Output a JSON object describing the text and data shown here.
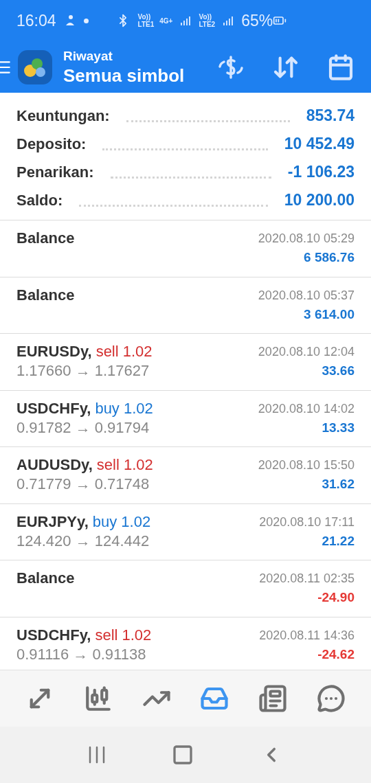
{
  "status_bar": {
    "time": "16:04",
    "volte1": "Vo))",
    "lte1": "LTE1",
    "net": "4G+",
    "volte2": "Vo))",
    "lte2": "LTE2",
    "battery": "65%"
  },
  "header": {
    "subtitle": "Riwayat",
    "title": "Semua simbol"
  },
  "summary": [
    {
      "label": "Keuntungan:",
      "value": "853.74"
    },
    {
      "label": "Deposito:",
      "value": "10 452.49"
    },
    {
      "label": "Penarikan:",
      "value": "-1 106.23"
    },
    {
      "label": "Saldo:",
      "value": "10 200.00"
    }
  ],
  "history": [
    {
      "kind": "balance",
      "title": "Balance",
      "time": "2020.08.10 05:29",
      "profit": "6 586.76",
      "loss": false
    },
    {
      "kind": "balance",
      "title": "Balance",
      "time": "2020.08.10 05:37",
      "profit": "3 614.00",
      "loss": false
    },
    {
      "kind": "trade",
      "symbol": "EURUSDy,",
      "type": "sell",
      "volume": "1.02",
      "prices": "1.17660 → 1.17627",
      "time": "2020.08.10 12:04",
      "profit": "33.66",
      "loss": false
    },
    {
      "kind": "trade",
      "symbol": "USDCHFy,",
      "type": "buy",
      "volume": "1.02",
      "prices": "0.91782 → 0.91794",
      "time": "2020.08.10 14:02",
      "profit": "13.33",
      "loss": false
    },
    {
      "kind": "trade",
      "symbol": "AUDUSDy,",
      "type": "sell",
      "volume": "1.02",
      "prices": "0.71779 → 0.71748",
      "time": "2020.08.10 15:50",
      "profit": "31.62",
      "loss": false
    },
    {
      "kind": "trade",
      "symbol": "EURJPYy,",
      "type": "buy",
      "volume": "1.02",
      "prices": "124.420 → 124.442",
      "time": "2020.08.10 17:11",
      "profit": "21.22",
      "loss": false
    },
    {
      "kind": "balance",
      "title": "Balance",
      "time": "2020.08.11 02:35",
      "profit": "-24.90",
      "loss": true
    },
    {
      "kind": "trade",
      "symbol": "USDCHFy,",
      "type": "sell",
      "volume": "1.02",
      "prices": "0.91116 → 0.91138",
      "time": "2020.08.11 14:36",
      "profit": "-24.62",
      "loss": true
    }
  ],
  "bottom_nav": [
    {
      "selected": false
    },
    {
      "selected": false
    },
    {
      "selected": false
    },
    {
      "selected": true
    },
    {
      "selected": false
    },
    {
      "selected": false
    }
  ]
}
